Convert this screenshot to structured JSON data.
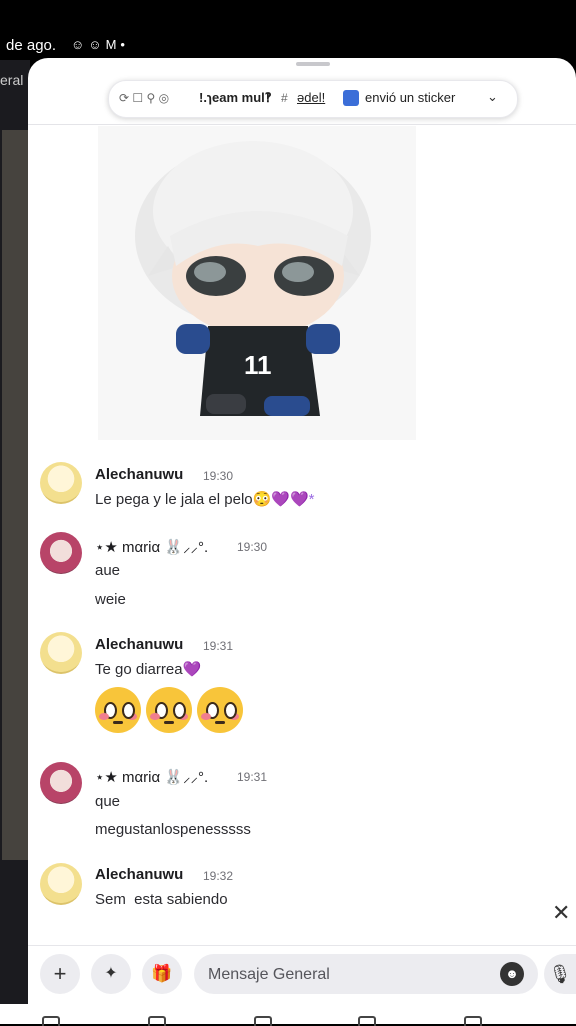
{
  "status_bar": {
    "text": "de ago.",
    "icons": [
      "discord-icon",
      "discord-icon",
      "gmail-icon",
      "dot-icon"
    ]
  },
  "background": {
    "text": "eral"
  },
  "banner": {
    "team": "ǃ.ɿeam mul‽",
    "hash": "#",
    "adel": "ədel!",
    "action": "envió un sticker"
  },
  "messages": [
    {
      "author": "Alechanuwu",
      "time": "19:30",
      "lines": [
        "Le pega y le jala el pelo"
      ],
      "trail": "😳💜💜*"
    },
    {
      "author": "⋆★ mαriα 🐰⸝⸝°.",
      "time": "19:30",
      "lines": [
        "aue",
        "weie"
      ]
    },
    {
      "author": "Alechanuwu",
      "time": "19:31",
      "lines": [
        "Te go diarrea"
      ],
      "trail": "💜",
      "emojis": 3
    },
    {
      "author": "⋆★ mαriα 🐰⸝⸝°.",
      "time": "19:31",
      "lines": [
        "que",
        "megustanlospenesssss"
      ]
    },
    {
      "author": "Alechanuwu",
      "time": "19:32",
      "lines": [
        "Sem  esta sabiendo"
      ]
    }
  ],
  "composer": {
    "placeholder": "Mensaje General",
    "icons": [
      "plus-icon",
      "apps-icon",
      "gift-icon",
      "emoji-icon",
      "mic-icon"
    ]
  },
  "colors": {
    "accent_heart": "#9b6be3",
    "input_bg": "#ececf0",
    "text": "#1f1f24"
  }
}
